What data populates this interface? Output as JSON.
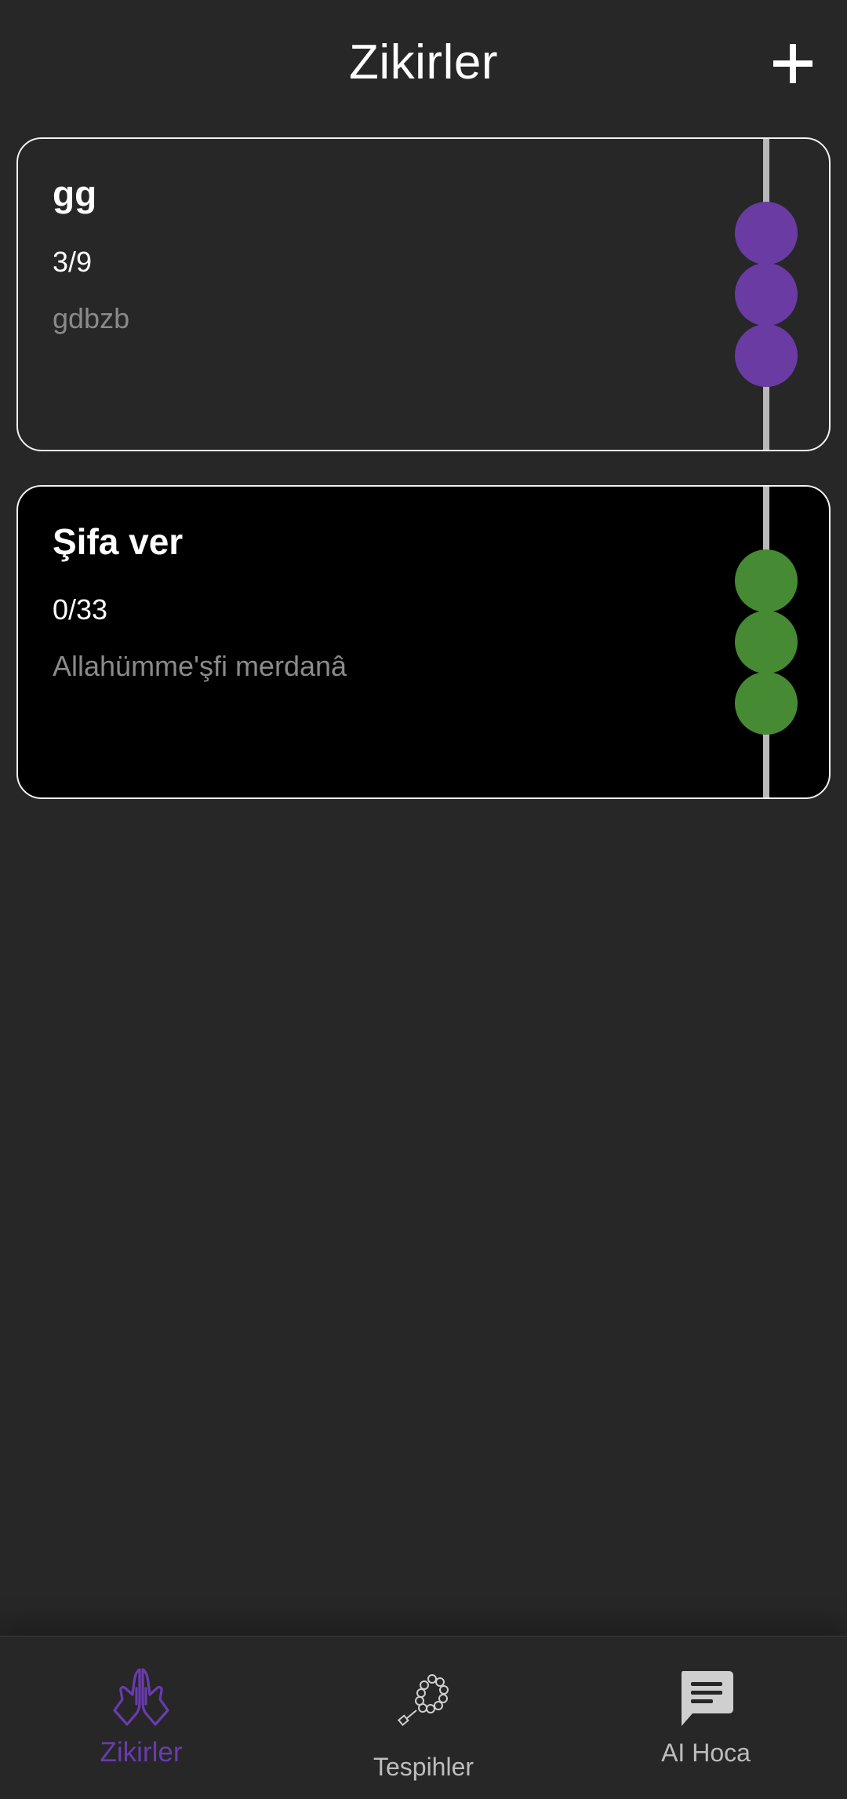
{
  "header": {
    "title": "Zikirler",
    "add_icon": "plus-icon"
  },
  "zikirs": [
    {
      "title": "gg",
      "count": "3/9",
      "description": "gdbzb",
      "bead_color": "#6a3ba3",
      "card_background": "#272727"
    },
    {
      "title": "Şifa ver",
      "count": "0/33",
      "description": "Allahümme'şfi merdanâ",
      "bead_color": "#468a33",
      "card_background": "#000000"
    }
  ],
  "bottom_nav": {
    "active_color": "#6a3bb0",
    "inactive_color": "#bdbdbd",
    "items": [
      {
        "label": "Zikirler",
        "icon": "praying-hands-icon",
        "active": true
      },
      {
        "label": "Tespihler",
        "icon": "prayer-beads-icon",
        "active": false
      },
      {
        "label": "AI Hoca",
        "icon": "chat-bubble-icon",
        "active": false
      }
    ]
  }
}
